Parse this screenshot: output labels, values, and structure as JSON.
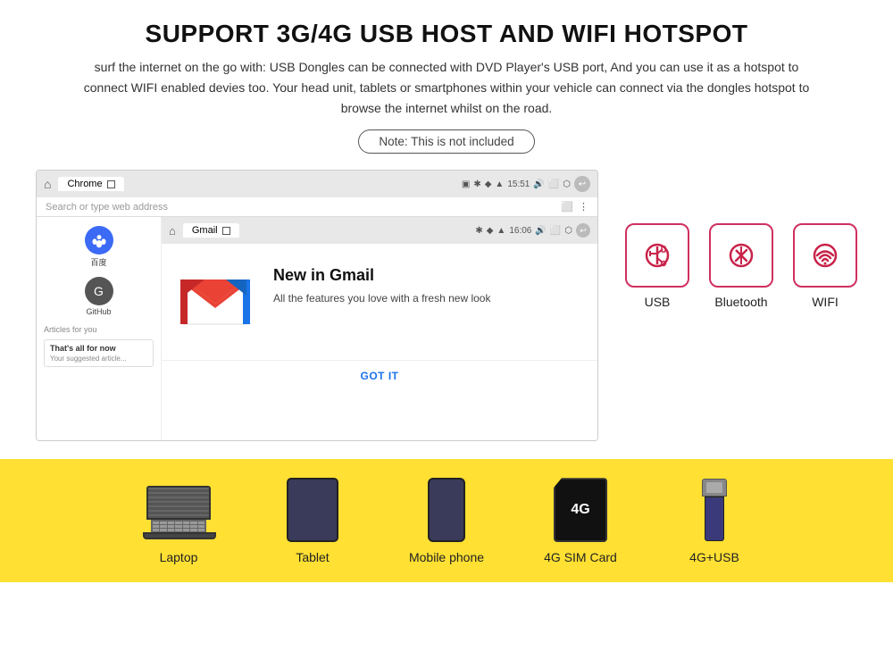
{
  "header": {
    "title": "SUPPORT 3G/4G USB HOST AND WIFI HOTSPOT",
    "subtitle": "surf the internet on the go with: USB Dongles can be connected with DVD Player's USB port, And you can use it as a hotspot to connect WIFI enabled devies too. Your head unit, tablets or smartphones within your vehicle can connect via the dongles hotspot to browse the internet whilst on the road.",
    "note": "Note: This is not included"
  },
  "browser": {
    "tab_name": "Chrome",
    "time": "15:51",
    "search_placeholder": "Search or type web address",
    "baidu_label": "百度",
    "github_label": "GitHub",
    "articles_label": "Articles for you",
    "card1_title": "That's all for now",
    "card1_sub": "Your suggested article..."
  },
  "gmail": {
    "tab_name": "Gmail",
    "time": "16:06",
    "new_title": "New in Gmail",
    "new_sub": "All the features you love with a fresh new look",
    "got_it": "GOT IT"
  },
  "connectivity_icons": [
    {
      "id": "usb",
      "label": "USB"
    },
    {
      "id": "bluetooth",
      "label": "Bluetooth"
    },
    {
      "id": "wifi",
      "label": "WIFI"
    }
  ],
  "devices": [
    {
      "id": "laptop",
      "label": "Laptop"
    },
    {
      "id": "tablet",
      "label": "Tablet"
    },
    {
      "id": "phone",
      "label": "Mobile phone"
    },
    {
      "id": "sim",
      "label": "4G SIM Card",
      "text1": "4G"
    },
    {
      "id": "usb_stick",
      "label": "4G+USB"
    }
  ],
  "colors": {
    "icon_border": "#c8234a",
    "bottom_bg": "#ffe033",
    "gmail_m_red": "#ea4335",
    "gmail_m_blue": "#1a73e8",
    "got_it_color": "#1a73e8"
  }
}
